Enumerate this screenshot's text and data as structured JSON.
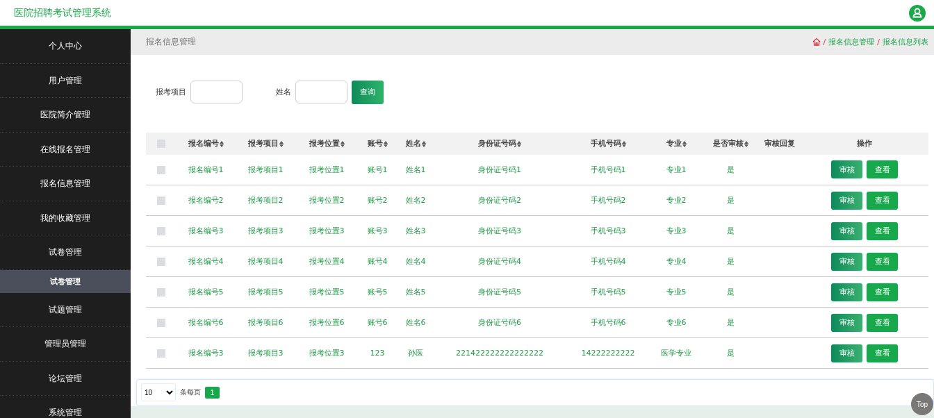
{
  "header": {
    "title": "医院招聘考试管理系统"
  },
  "sidebar": {
    "items": [
      {
        "label": "个人中心"
      },
      {
        "label": "用户管理"
      },
      {
        "label": "医院简介管理"
      },
      {
        "label": "在线报名管理"
      },
      {
        "label": "报名信息管理"
      },
      {
        "label": "我的收藏管理"
      },
      {
        "label": "试卷管理",
        "children": [
          {
            "label": "试卷管理"
          }
        ]
      },
      {
        "label": "试题管理"
      },
      {
        "label": "管理员管理"
      },
      {
        "label": "论坛管理"
      },
      {
        "label": "系统管理"
      }
    ]
  },
  "page_title": "报名信息管理",
  "breadcrumb": [
    {
      "separator": "/",
      "label": "报名信息管理"
    },
    {
      "separator": "/",
      "label": "报名信息列表"
    }
  ],
  "search": {
    "fields": [
      {
        "label": "报考项目"
      },
      {
        "label": "姓名"
      }
    ],
    "button": "查询"
  },
  "table": {
    "select_all": {
      "checked": false
    },
    "columns": [
      {
        "label": "报名编号",
        "sortable": true
      },
      {
        "label": "报考项目",
        "sortable": true
      },
      {
        "label": "报考位置",
        "sortable": true
      },
      {
        "label": "账号",
        "sortable": true
      },
      {
        "label": "姓名",
        "sortable": true
      },
      {
        "label": "身份证号码",
        "sortable": true
      },
      {
        "label": "手机号码",
        "sortable": true
      },
      {
        "label": "专业",
        "sortable": true
      },
      {
        "label": "是否审核",
        "sortable": true
      },
      {
        "label": "审核回复",
        "sortable": false
      },
      {
        "label": "操作",
        "sortable": false
      }
    ],
    "rows": [
      {
        "checked": false,
        "cells": [
          "报名编号1",
          "报考项目1",
          "报考位置1",
          "账号1",
          "姓名1",
          "身份证号码1",
          "手机号码1",
          "专业1",
          "是",
          ""
        ],
        "actions": [
          "审核",
          "查看"
        ]
      },
      {
        "checked": false,
        "cells": [
          "报名编号2",
          "报考项目2",
          "报考位置2",
          "账号2",
          "姓名2",
          "身份证号码2",
          "手机号码2",
          "专业2",
          "是",
          ""
        ],
        "actions": [
          "审核",
          "查看"
        ]
      },
      {
        "checked": false,
        "cells": [
          "报名编号3",
          "报考项目3",
          "报考位置3",
          "账号3",
          "姓名3",
          "身份证号码3",
          "手机号码3",
          "专业3",
          "是",
          ""
        ],
        "actions": [
          "审核",
          "查看"
        ]
      },
      {
        "checked": false,
        "cells": [
          "报名编号4",
          "报考项目4",
          "报考位置4",
          "账号4",
          "姓名4",
          "身份证号码4",
          "手机号码4",
          "专业4",
          "是",
          ""
        ],
        "actions": [
          "审核",
          "查看"
        ]
      },
      {
        "checked": false,
        "cells": [
          "报名编号5",
          "报考项目5",
          "报考位置5",
          "账号5",
          "姓名5",
          "身份证号码5",
          "手机号码5",
          "专业5",
          "是",
          ""
        ],
        "actions": [
          "审核",
          "查看"
        ]
      },
      {
        "checked": false,
        "cells": [
          "报名编号6",
          "报考项目6",
          "报考位置6",
          "账号6",
          "姓名6",
          "身份证号码6",
          "手机号码6",
          "专业6",
          "是",
          ""
        ],
        "actions": [
          "审核",
          "查看"
        ]
      },
      {
        "checked": false,
        "cells": [
          "报名编号3",
          "报考项目3",
          "报考位置3",
          "123",
          "孙医",
          "221422222222222222",
          "14222222222",
          "医学专业",
          "是",
          ""
        ],
        "actions": [
          "审核",
          "查看"
        ]
      }
    ]
  },
  "pagination": {
    "page_size": "10",
    "per_page_label": "条每页",
    "pages": [
      {
        "label": "1",
        "selected": true
      }
    ]
  },
  "back_to_top": "Top"
}
